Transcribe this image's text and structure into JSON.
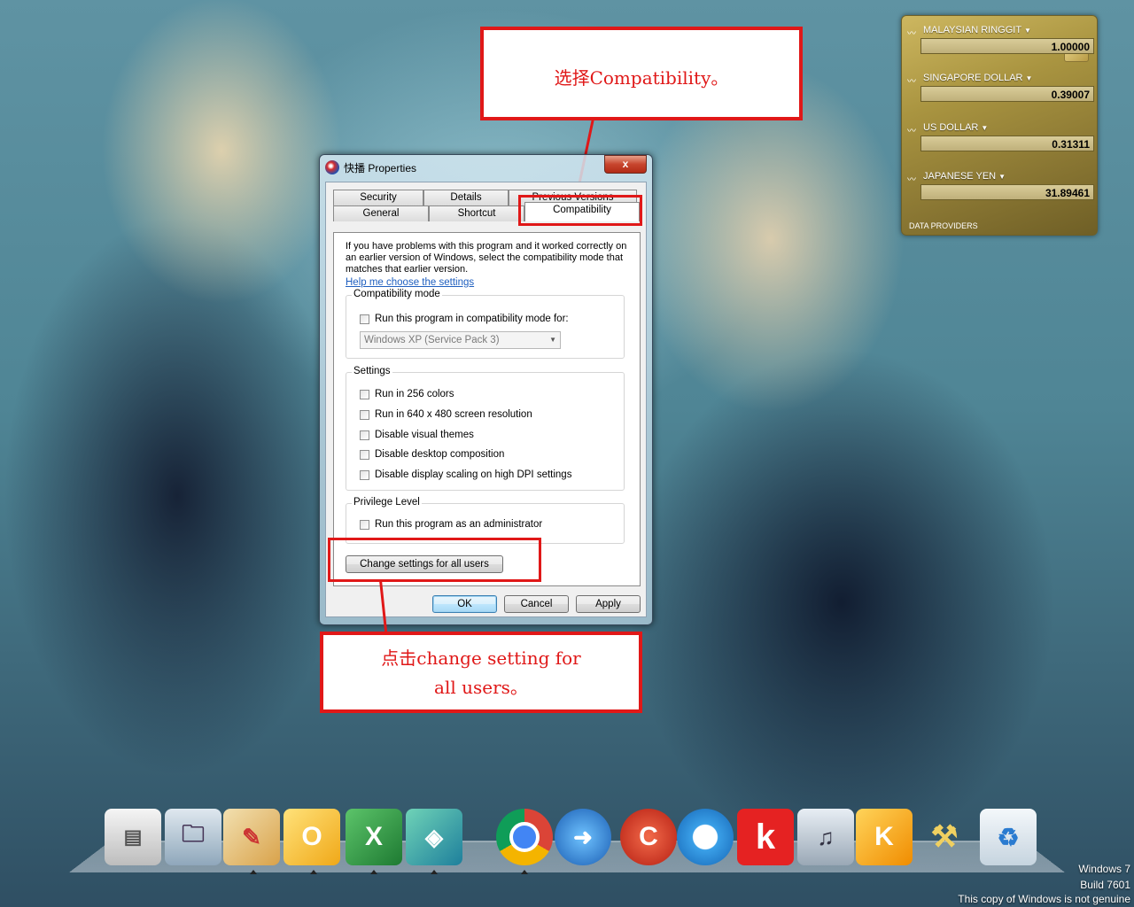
{
  "callouts": {
    "top": "选择Compatibility。",
    "bottom_line1": "点击change setting for",
    "bottom_line2": "all users。"
  },
  "gadget": {
    "rows": [
      {
        "label": "MALAYSIAN RINGGIT",
        "value": "1.00000"
      },
      {
        "label": "SINGAPORE DOLLAR",
        "value": "0.39007"
      },
      {
        "label": "US DOLLAR",
        "value": "0.31311"
      },
      {
        "label": "JAPANESE YEN",
        "value": "31.89461"
      }
    ],
    "providers": "DATA PROVIDERS"
  },
  "dialog": {
    "title": "快播 Properties",
    "close": "x",
    "tabs": {
      "security": "Security",
      "details": "Details",
      "previous_versions": "Previous Versions",
      "general": "General",
      "shortcut": "Shortcut",
      "compatibility": "Compatibility"
    },
    "info": "If you have problems with this program and it worked correctly on an earlier version of Windows, select the compatibility mode that matches that earlier version.",
    "help_link": "Help me choose the settings",
    "compat_mode": {
      "legend": "Compatibility mode",
      "run_in_mode": "Run this program in compatibility mode for:",
      "selected_os": "Windows XP (Service Pack 3)"
    },
    "settings": {
      "legend": "Settings",
      "items": [
        "Run in 256 colors",
        "Run in 640 x 480 screen resolution",
        "Disable visual themes",
        "Disable desktop composition",
        "Disable display scaling on high DPI settings"
      ]
    },
    "privilege": {
      "legend": "Privilege Level",
      "run_as_admin": "Run this program as an administrator"
    },
    "change_all_users": "Change settings for all users",
    "buttons": {
      "ok": "OK",
      "cancel": "Cancel",
      "apply": "Apply"
    }
  },
  "dock": {
    "icons": [
      "display-settings-icon",
      "documents-folder-icon",
      "paint-palette-icon",
      "outlook-icon",
      "excel-icon",
      "network-box-icon",
      "chrome-icon",
      "download-manager-icon",
      "ccleaner-icon",
      "qq-browser-icon",
      "k-app-icon",
      "media-player-icon",
      "kugou-music-icon",
      "tools-icon",
      "recycle-bin-icon"
    ]
  },
  "watermark": {
    "line1": "Windows 7",
    "line2": "Build 7601",
    "line3": "This copy of Windows is not genuine"
  },
  "colors": {
    "callout_red": "#e01818",
    "link_blue": "#1f5fbf"
  }
}
